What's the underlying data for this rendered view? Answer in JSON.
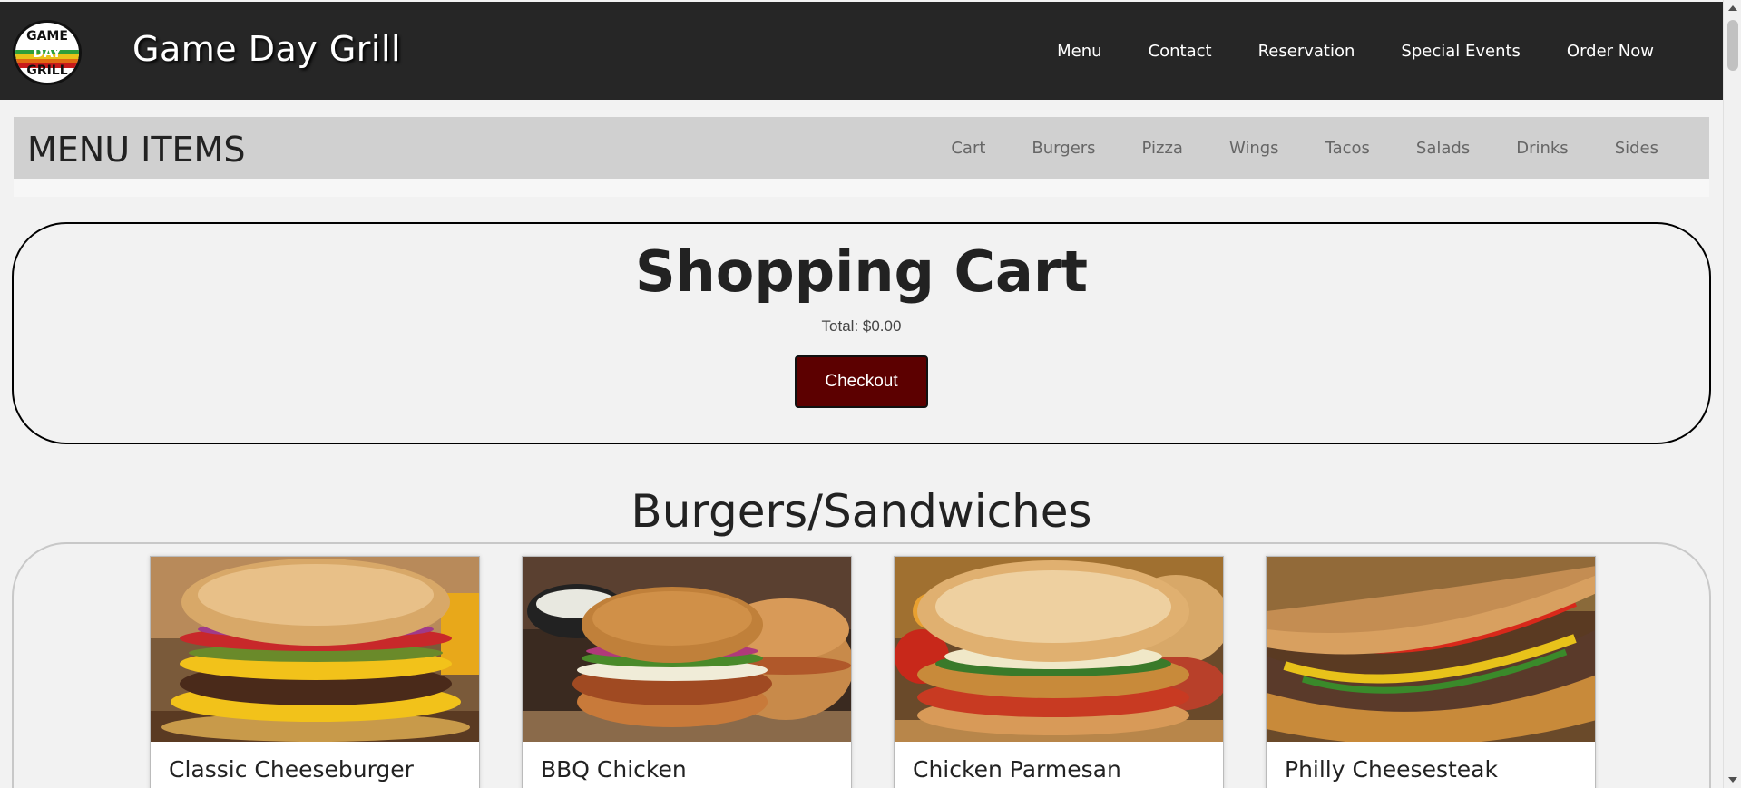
{
  "header": {
    "logo_lines": [
      "GAME",
      "DAY",
      "GRILL"
    ],
    "brand": "Game Day Grill",
    "nav": [
      "Menu",
      "Contact",
      "Reservation",
      "Special Events",
      "Order Now"
    ]
  },
  "menu_bar": {
    "title": "MENU ITEMS",
    "categories": [
      "Cart",
      "Burgers",
      "Pizza",
      "Wings",
      "Tacos",
      "Salads",
      "Drinks",
      "Sides"
    ]
  },
  "cart": {
    "title": "Shopping Cart",
    "total": "Total: $0.00",
    "checkout_label": "Checkout"
  },
  "section": {
    "title": "Burgers/Sandwiches",
    "items": [
      {
        "name": "Classic Cheeseburger"
      },
      {
        "name": "BBQ Chicken"
      },
      {
        "name": "Chicken Parmesan"
      },
      {
        "name": "Philly Cheesesteak"
      }
    ]
  },
  "colors": {
    "header_bg": "#262626",
    "checkout_bg": "#5c0000",
    "subbar_bg": "#d0d0d0",
    "page_bg": "#f2f2f2"
  }
}
